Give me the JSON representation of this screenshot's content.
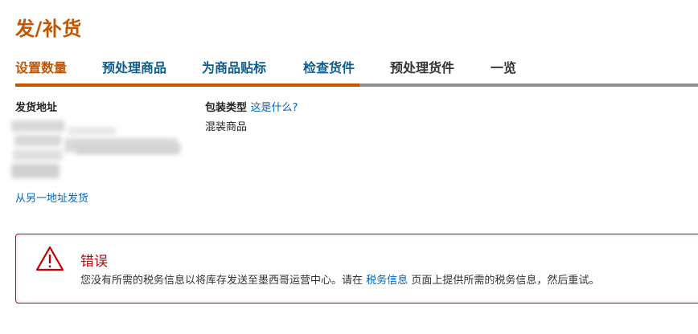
{
  "page_title": "发/补货",
  "tabs": [
    {
      "label": "设置数量",
      "state": "current"
    },
    {
      "label": "预处理商品",
      "state": "link"
    },
    {
      "label": "为商品贴标",
      "state": "link"
    },
    {
      "label": "检查货件",
      "state": "link"
    },
    {
      "label": "预处理货件",
      "state": "plain"
    },
    {
      "label": "一览",
      "state": "plain"
    }
  ],
  "ship_from": {
    "label": "发货地址",
    "change_link": "从另一地址发货"
  },
  "packing": {
    "label": "包装类型",
    "help_link": "这是什么?",
    "value": "混装商品"
  },
  "alert": {
    "icon": "warning-triangle-icon",
    "title": "错误",
    "message_before": "您没有所需的税务信息以将库存发送至墨西哥运营中心。请在",
    "message_link": "税务信息",
    "message_after": "页面上提供所需的税务信息，然后重试。"
  },
  "colors": {
    "accent": "#c45500",
    "link": "#0066c0",
    "error": "#c40000"
  }
}
